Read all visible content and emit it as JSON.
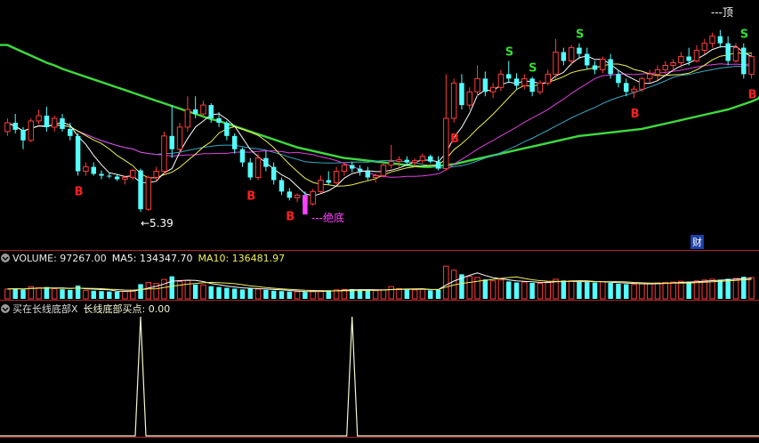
{
  "colors": {
    "background": "#000000",
    "up": "#ff3c3c",
    "down": "#54ffff",
    "ma_long": "#3ddc3d",
    "ma_white": "#ffffff",
    "ma_yellow": "#f0f056",
    "ma_magenta": "#e040e0",
    "ma_teal": "#3aa7c4",
    "buy_mark": "#ff2020",
    "sell_mark": "#33dd33",
    "signal_line": "#f5f5d0",
    "label_color": "#ff40ff",
    "separator": "#b0232a"
  },
  "price_panel": {
    "low_label": "←5.39",
    "bottom_label": "---绝底",
    "top_label": "---顶",
    "finance_badge": "财",
    "buy_symbol": "B",
    "sell_symbol": "S"
  },
  "volume_header": {
    "name": "VOLUME: 97267.00",
    "ma5": "MA5: 134347.70",
    "ma10": "MA10: 136481.97"
  },
  "signal_header": {
    "name": "买在长线底部X",
    "value": "长线底部买点: 0.00"
  },
  "chart_data": [
    {
      "type": "candlestick",
      "title": "",
      "candles": [
        [
          6.3,
          6.45,
          6.25,
          6.4
        ],
        [
          6.4,
          6.5,
          6.28,
          6.32
        ],
        [
          6.32,
          6.35,
          6.1,
          6.2
        ],
        [
          6.2,
          6.45,
          6.18,
          6.42
        ],
        [
          6.42,
          6.55,
          6.38,
          6.48
        ],
        [
          6.48,
          6.58,
          6.3,
          6.35
        ],
        [
          6.35,
          6.48,
          6.3,
          6.45
        ],
        [
          6.45,
          6.5,
          6.3,
          6.33
        ],
        [
          6.33,
          6.4,
          6.2,
          6.25
        ],
        [
          6.25,
          6.28,
          5.8,
          5.85
        ],
        [
          5.85,
          5.95,
          5.8,
          5.9
        ],
        [
          5.9,
          5.95,
          5.8,
          5.82
        ],
        [
          5.82,
          5.86,
          5.76,
          5.8
        ],
        [
          5.8,
          5.84,
          5.77,
          5.79
        ],
        [
          5.79,
          5.82,
          5.74,
          5.76
        ],
        [
          5.76,
          5.8,
          5.7,
          5.78
        ],
        [
          5.78,
          5.88,
          5.75,
          5.86
        ],
        [
          5.86,
          5.88,
          5.39,
          5.42
        ],
        [
          5.42,
          5.8,
          5.4,
          5.78
        ],
        [
          5.78,
          5.9,
          5.75,
          5.85
        ],
        [
          5.85,
          6.3,
          5.82,
          6.25
        ],
        [
          6.25,
          6.6,
          6.0,
          6.1
        ],
        [
          6.1,
          6.4,
          6.05,
          6.35
        ],
        [
          6.35,
          6.7,
          6.3,
          6.55
        ],
        [
          6.55,
          6.7,
          6.45,
          6.5
        ],
        [
          6.5,
          6.65,
          6.45,
          6.6
        ],
        [
          6.6,
          6.62,
          6.4,
          6.45
        ],
        [
          6.45,
          6.52,
          6.35,
          6.4
        ],
        [
          6.4,
          6.42,
          6.2,
          6.25
        ],
        [
          6.25,
          6.28,
          6.05,
          6.1
        ],
        [
          6.1,
          6.12,
          5.9,
          5.95
        ],
        [
          5.95,
          6.0,
          5.75,
          5.78
        ],
        [
          5.78,
          6.05,
          5.75,
          6.0
        ],
        [
          6.0,
          6.08,
          5.85,
          5.9
        ],
        [
          5.9,
          5.95,
          5.7,
          5.75
        ],
        [
          5.75,
          5.78,
          5.58,
          5.62
        ],
        [
          5.62,
          5.66,
          5.52,
          5.55
        ],
        [
          5.55,
          5.6,
          5.5,
          5.58
        ],
        [
          5.58,
          5.62,
          5.45,
          5.48
        ],
        [
          5.48,
          5.65,
          5.46,
          5.62
        ],
        [
          5.62,
          5.8,
          5.6,
          5.75
        ],
        [
          5.75,
          5.85,
          5.7,
          5.72
        ],
        [
          5.72,
          5.9,
          5.7,
          5.85
        ],
        [
          5.85,
          5.95,
          5.8,
          5.92
        ],
        [
          5.92,
          5.96,
          5.84,
          5.88
        ],
        [
          5.88,
          5.92,
          5.8,
          5.85
        ],
        [
          5.85,
          5.9,
          5.75,
          5.78
        ],
        [
          5.78,
          5.82,
          5.72,
          5.8
        ],
        [
          5.8,
          5.95,
          5.78,
          5.92
        ],
        [
          5.92,
          6.15,
          5.88,
          5.96
        ],
        [
          5.96,
          6.02,
          5.9,
          5.98
        ],
        [
          5.98,
          6.02,
          5.92,
          5.95
        ],
        [
          5.95,
          6.0,
          5.9,
          5.97
        ],
        [
          5.97,
          6.05,
          5.94,
          6.02
        ],
        [
          6.02,
          6.04,
          5.94,
          5.96
        ],
        [
          5.96,
          6.02,
          5.86,
          5.88
        ],
        [
          5.88,
          6.95,
          5.86,
          6.45
        ],
        [
          6.45,
          6.9,
          6.4,
          6.85
        ],
        [
          6.85,
          6.95,
          6.55,
          6.6
        ],
        [
          6.6,
          6.8,
          6.55,
          6.75
        ],
        [
          6.75,
          7.05,
          6.7,
          6.9
        ],
        [
          6.9,
          6.98,
          6.7,
          6.75
        ],
        [
          6.75,
          6.85,
          6.68,
          6.8
        ],
        [
          6.8,
          7.0,
          6.76,
          6.95
        ],
        [
          6.95,
          7.1,
          6.85,
          6.9
        ],
        [
          6.9,
          6.96,
          6.78,
          6.82
        ],
        [
          6.82,
          6.95,
          6.78,
          6.9
        ],
        [
          6.9,
          6.92,
          6.7,
          6.75
        ],
        [
          6.75,
          6.88,
          6.72,
          6.85
        ],
        [
          6.85,
          7.0,
          6.82,
          6.95
        ],
        [
          6.95,
          7.35,
          6.9,
          7.2
        ],
        [
          7.2,
          7.25,
          7.05,
          7.1
        ],
        [
          7.1,
          7.28,
          7.05,
          7.25
        ],
        [
          7.25,
          7.3,
          7.12,
          7.18
        ],
        [
          7.18,
          7.25,
          7.0,
          7.05
        ],
        [
          7.05,
          7.1,
          6.95,
          7.0
        ],
        [
          7.0,
          7.15,
          6.96,
          7.12
        ],
        [
          7.12,
          7.18,
          6.9,
          6.95
        ],
        [
          6.95,
          7.0,
          6.8,
          6.85
        ],
        [
          6.85,
          6.9,
          6.7,
          6.75
        ],
        [
          6.75,
          6.82,
          6.68,
          6.78
        ],
        [
          6.78,
          6.92,
          6.75,
          6.9
        ],
        [
          6.9,
          7.0,
          6.85,
          6.95
        ],
        [
          6.95,
          7.05,
          6.88,
          7.0
        ],
        [
          7.0,
          7.1,
          6.95,
          7.05
        ],
        [
          7.05,
          7.12,
          6.98,
          7.08
        ],
        [
          7.08,
          7.2,
          7.02,
          7.15
        ],
        [
          7.15,
          7.25,
          7.05,
          7.1
        ],
        [
          7.1,
          7.28,
          7.08,
          7.22
        ],
        [
          7.22,
          7.35,
          7.18,
          7.3
        ],
        [
          7.3,
          7.42,
          7.25,
          7.38
        ],
        [
          7.38,
          7.45,
          7.25,
          7.3
        ],
        [
          7.3,
          7.38,
          7.05,
          7.1
        ],
        [
          7.1,
          7.3,
          7.08,
          7.25
        ],
        [
          7.25,
          7.3,
          6.9,
          6.95
        ],
        [
          6.95,
          7.2,
          6.9,
          7.15
        ]
      ],
      "ma_long": [
        7.28,
        7.24,
        7.2,
        7.16,
        7.12,
        7.08,
        7.05,
        7.01,
        6.98,
        6.95,
        6.92,
        6.89,
        6.86,
        6.83,
        6.8,
        6.77,
        6.74,
        6.71,
        6.68,
        6.65,
        6.62,
        6.59,
        6.56,
        6.53,
        6.5,
        6.47,
        6.44,
        6.42,
        6.39,
        6.36,
        6.33,
        6.3,
        6.27,
        6.24,
        6.21,
        6.18,
        6.15,
        6.12,
        6.1,
        6.08,
        6.06,
        6.04,
        6.02,
        6.0,
        5.99,
        5.98,
        5.97,
        5.96,
        5.95,
        5.94,
        5.93,
        5.92,
        5.91,
        5.9,
        5.9,
        5.91,
        5.92,
        5.93,
        5.95,
        5.97,
        5.99,
        6.01,
        6.03,
        6.05,
        6.07,
        6.09,
        6.11,
        6.13,
        6.15,
        6.17,
        6.19,
        6.21,
        6.23,
        6.25,
        6.26,
        6.27,
        6.28,
        6.29,
        6.3,
        6.31,
        6.32,
        6.33,
        6.35,
        6.37,
        6.39,
        6.41,
        6.43,
        6.45,
        6.47,
        6.49,
        6.51,
        6.53,
        6.55,
        6.58,
        6.61,
        6.64,
        6.68
      ],
      "buy_signals": [
        9,
        31,
        36,
        57,
        80,
        96
      ],
      "sell_signals": [
        64,
        67,
        73,
        94
      ]
    },
    {
      "type": "bar",
      "title": "VOLUME",
      "volumes": [
        48,
        52,
        45,
        60,
        55,
        58,
        50,
        47,
        44,
        65,
        42,
        40,
        38,
        36,
        35,
        37,
        42,
        72,
        80,
        75,
        95,
        110,
        85,
        90,
        70,
        68,
        62,
        58,
        54,
        50,
        46,
        52,
        48,
        44,
        40,
        38,
        36,
        35,
        34,
        38,
        40,
        42,
        44,
        46,
        48,
        45,
        42,
        40,
        44,
        60,
        50,
        46,
        44,
        48,
        42,
        45,
        160,
        140,
        120,
        110,
        105,
        95,
        88,
        92,
        85,
        80,
        82,
        78,
        76,
        84,
        96,
        90,
        88,
        85,
        82,
        80,
        84,
        78,
        74,
        72,
        70,
        74,
        76,
        78,
        80,
        82,
        86,
        84,
        88,
        92,
        96,
        94,
        98,
        100,
        108,
        104
      ],
      "ma5_label": "MA5",
      "ma10_label": "MA10"
    },
    {
      "type": "line",
      "title": "长线底部买点",
      "spikes": [
        17,
        44
      ],
      "value": 0.0
    }
  ]
}
